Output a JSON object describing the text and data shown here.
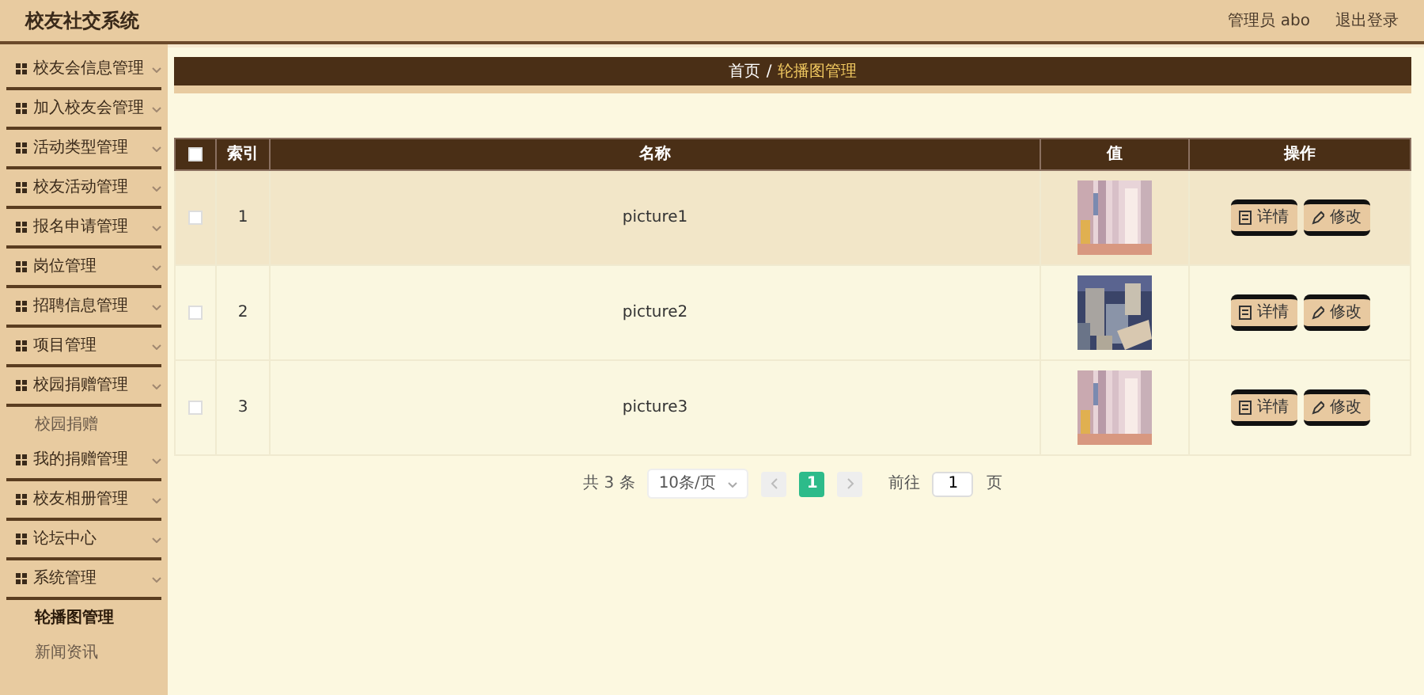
{
  "header": {
    "title": "校友社交系统",
    "user": "管理员 abo",
    "logout": "退出登录"
  },
  "sidebar": {
    "items": [
      {
        "label": "校友会信息管理"
      },
      {
        "label": "加入校友会管理"
      },
      {
        "label": "活动类型管理"
      },
      {
        "label": "校友活动管理"
      },
      {
        "label": "报名申请管理"
      },
      {
        "label": "岗位管理"
      },
      {
        "label": "招聘信息管理"
      },
      {
        "label": "项目管理"
      },
      {
        "label": "校园捐赠管理",
        "children": [
          {
            "label": "校园捐赠",
            "selected": false
          }
        ]
      },
      {
        "label": "我的捐赠管理"
      },
      {
        "label": "校友相册管理"
      },
      {
        "label": "论坛中心"
      },
      {
        "label": "系统管理",
        "children": [
          {
            "label": "轮播图管理",
            "selected": true
          },
          {
            "label": "新闻资讯",
            "selected": false
          }
        ]
      }
    ]
  },
  "breadcrumb": {
    "items": [
      "首页",
      "轮播图管理"
    ],
    "separator": "/"
  },
  "table": {
    "header_checkbox": {
      "checked": false
    },
    "columns": [
      "索引",
      "名称",
      "值",
      "操作"
    ],
    "rows": [
      {
        "checked": false,
        "highlighted": true,
        "index": "1",
        "name": "picture1",
        "image": {
          "kind": "picture"
        },
        "actions": [
          "详情",
          "修改"
        ]
      },
      {
        "checked": false,
        "highlighted": false,
        "index": "2",
        "name": "picture2",
        "image": {
          "kind": "picture"
        },
        "actions": [
          "详情",
          "修改"
        ]
      },
      {
        "checked": false,
        "highlighted": false,
        "index": "3",
        "name": "picture3",
        "image": {
          "kind": "picture"
        },
        "actions": [
          "详情",
          "修改"
        ]
      }
    ]
  },
  "pagination": {
    "total": "共 3 条",
    "page_size": "10条/页",
    "pages": [
      {
        "label": "1",
        "selected": true
      }
    ],
    "goto_label": "前往",
    "goto_value": "1",
    "page_unit": "页"
  }
}
